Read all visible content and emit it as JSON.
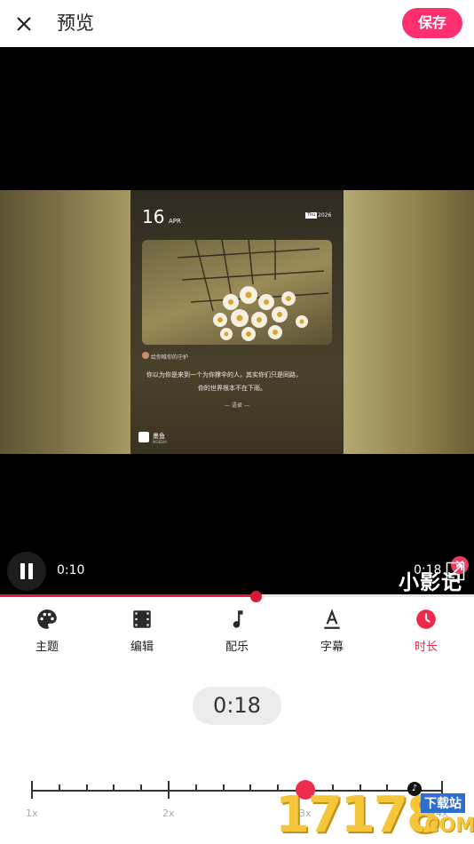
{
  "header": {
    "title": "预览",
    "save_label": "保存"
  },
  "video": {
    "card": {
      "day": "16",
      "month": "APR",
      "weekday_tag": "Thu",
      "year": "2026",
      "author": "给你唯你的守护",
      "quote_line1": "你以为你是来到一个为你撑伞的人，其实你们只是同路，",
      "quote_line2": "你的世界根本不在下雨。",
      "signature": "— 语录 —",
      "brand": "墨鱼",
      "brand_sub": "MOEDM"
    },
    "watermark": "小影记",
    "current_time": "0:10",
    "total_time": "0:18",
    "progress": 0.54
  },
  "tabs": [
    {
      "label": "主题",
      "icon": "palette-icon"
    },
    {
      "label": "编辑",
      "icon": "film-icon"
    },
    {
      "label": "配乐",
      "icon": "music-note-icon"
    },
    {
      "label": "字幕",
      "icon": "text-a-icon"
    },
    {
      "label": "时长",
      "icon": "clock-icon",
      "active": true
    }
  ],
  "duration_display": "0:18",
  "speed_scale": {
    "labels": [
      "1x",
      "2x",
      "3x",
      "4x"
    ],
    "value": 3.05
  },
  "colors": {
    "accent": "#ff2e6f",
    "active_tab": "#f0284a",
    "progress": "#e01e3c"
  },
  "site_watermark": {
    "number": "17178",
    "tag": "下载站",
    "domain": ".COM"
  }
}
